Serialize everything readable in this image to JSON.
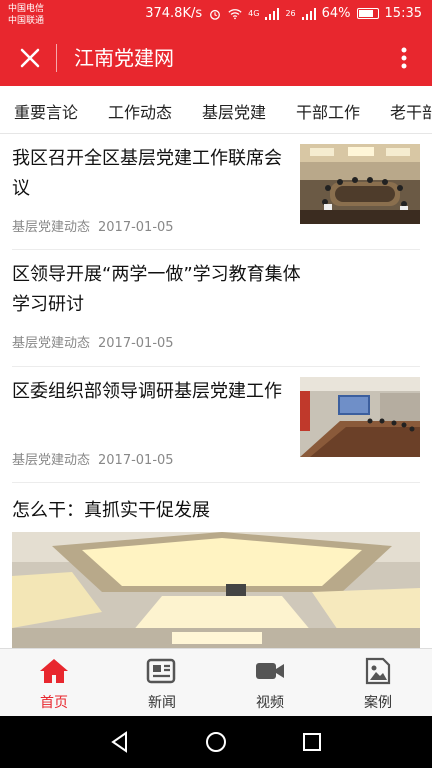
{
  "status": {
    "carrier1": "中国电信",
    "carrier2": "中国联通",
    "speed": "374.8K/s",
    "net_tag": "4G",
    "net_tag2": "26",
    "battery": "64%",
    "time": "15:35"
  },
  "appbar": {
    "title": "江南党建网"
  },
  "tabs": [
    "重要言论",
    "工作动态",
    "基层党建",
    "干部工作",
    "老干部"
  ],
  "news": [
    {
      "title": "我区召开全区基层党建工作联席会议",
      "category": "基层党建动态",
      "date": "2017-01-05",
      "thumb": "meeting-room-photo"
    },
    {
      "title": "区领导开展“两学一做”学习教育集体学习研讨",
      "category": "基层党建动态",
      "date": "2017-01-05"
    },
    {
      "title": "区委组织部领导调研基层党建工作",
      "category": "基层党建动态",
      "date": "2017-01-05",
      "thumb": "meeting-projector-photo"
    }
  ],
  "featured": {
    "title": "怎么干：真抓实干促发展",
    "image": "ceiling-lights-photo"
  },
  "bottom_nav": [
    {
      "label": "首页",
      "icon": "home-icon",
      "active": true
    },
    {
      "label": "新闻",
      "icon": "newspaper-icon",
      "active": false
    },
    {
      "label": "视频",
      "icon": "video-camera-icon",
      "active": false
    },
    {
      "label": "案例",
      "icon": "image-icon",
      "active": false
    }
  ],
  "colors": {
    "primary": "#e8272e",
    "nav_bg": "#f7f7f7",
    "meta_text": "#888888"
  }
}
